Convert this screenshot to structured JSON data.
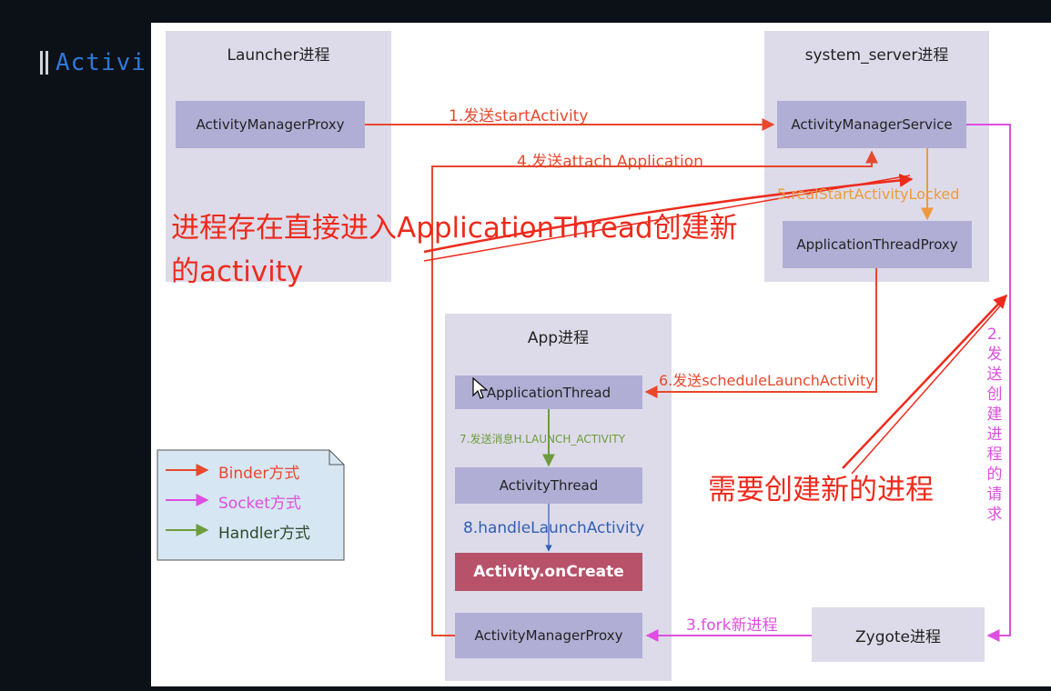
{
  "slide_title": "Activi",
  "processes": {
    "launcher": {
      "title": "Launcher进程"
    },
    "system_server": {
      "title": "system_server进程"
    },
    "app": {
      "title": "App进程"
    }
  },
  "nodes": {
    "launcher_amp": "ActivityManagerProxy",
    "ams": "ActivityManagerService",
    "atp": "ApplicationThreadProxy",
    "app_thread": "ApplicationThread",
    "activity_thread": "ActivityThread",
    "on_create": "Activity.onCreate",
    "app_amp": "ActivityManagerProxy",
    "zygote": "Zygote进程"
  },
  "steps": {
    "s1": "1.发送startActivity",
    "s2": "2.发送创建进程的请求",
    "s3": "3.fork新进程",
    "s4": "4.发送attach Application",
    "s5": "5.realStartActivityLocked",
    "s6": "6.发送scheduleLaunchActivity",
    "s7": "7.发送消息H.LAUNCH_ACTIVITY",
    "s8": "8.handleLaunchActivity"
  },
  "legend": {
    "binder": "Binder方式",
    "socket": "Socket方式",
    "handler": "Handler方式"
  },
  "annotations": {
    "existing_line1": "进程存在直接进入ApplicationThread创建新",
    "existing_line2": "的activity",
    "new_process": "需要创建新的进程"
  },
  "colors": {
    "binder": "#e8482c",
    "socket": "#de4ee0",
    "handler": "#6d9c3c",
    "handle_launch": "#2f5fb4",
    "realstart": "#ee9a3c",
    "annotation": "#ee2a1c",
    "process_bg": "#dddbe9",
    "node_bg": "#b1aed5",
    "oncreate_bg": "#b8526a",
    "legend_bg": "#d7e6f3"
  }
}
